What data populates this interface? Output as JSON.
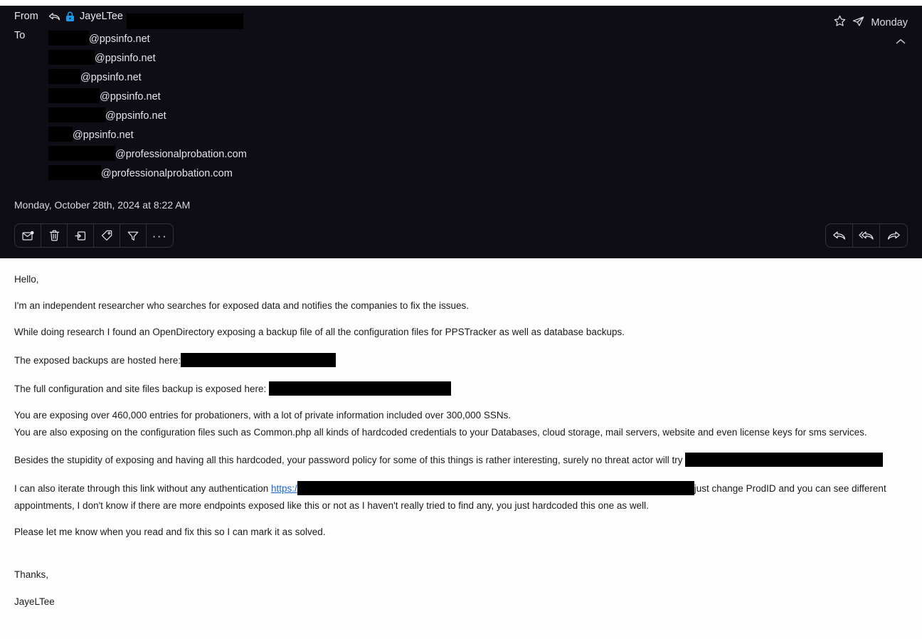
{
  "theme": {
    "header_bg": "#0e0c14",
    "body_bg": "#fdfdfd",
    "header_text": "#e8e8ea",
    "body_text": "#1a1a1a",
    "link_color": "#1967d2",
    "lock_color": "#1a9ae8",
    "redaction_color": "#000000"
  },
  "header": {
    "from_label": "From",
    "to_label": "To",
    "sender_name": "JayeLTee",
    "sender_redacted": true,
    "reply_indicator_icon": "reply-arrow-icon",
    "lock_icon": "lock-icon",
    "recipients": [
      {
        "redacted_width": 57,
        "domain": "@ppsinfo.net"
      },
      {
        "redacted_width": 65,
        "domain": "@ppsinfo.net"
      },
      {
        "redacted_width": 45,
        "domain": "@ppsinfo.net"
      },
      {
        "redacted_width": 72,
        "domain": "@ppsinfo.net"
      },
      {
        "redacted_width": 80,
        "domain": "@ppsinfo.net"
      },
      {
        "redacted_width": 34,
        "domain": "@ppsinfo.net"
      },
      {
        "redacted_width": 94,
        "domain": "@professionalprobation.com"
      },
      {
        "redacted_width": 74,
        "domain": "@professionalprobation.com"
      }
    ],
    "date": "Monday, October 28th, 2024 at 8:22 AM",
    "day_badge": "Monday",
    "star_icon": "star-icon",
    "send_icon": "paper-plane-icon",
    "collapse_icon": "chevron-up-icon"
  },
  "toolbar_left": [
    {
      "name": "mark-unread-button",
      "icon": "envelope-dot-icon"
    },
    {
      "name": "delete-button",
      "icon": "trash-icon"
    },
    {
      "name": "move-to-folder-button",
      "icon": "move-to-folder-icon"
    },
    {
      "name": "tag-button",
      "icon": "tag-icon"
    },
    {
      "name": "filter-button",
      "icon": "funnel-icon"
    },
    {
      "name": "more-options-button",
      "icon": "ellipsis-icon",
      "glyph": "···"
    }
  ],
  "toolbar_right": [
    {
      "name": "reply-button",
      "icon": "reply-arrow-icon"
    },
    {
      "name": "reply-all-button",
      "icon": "reply-all-arrow-icon"
    },
    {
      "name": "forward-button",
      "icon": "forward-arrow-icon"
    }
  ],
  "body": {
    "greeting": "Hello,",
    "p_intro": "I'm an independent researcher who searches for exposed data and notifies the companies to fix the issues.",
    "p_research": "While doing research I found an OpenDirectory exposing a backup file of all the configuration files for PPSTracker as well as database backups.",
    "p_backups_prefix": "The exposed backups are hosted here:",
    "p_backups_redact_width": 218,
    "p_fullconfig_prefix": "The full configuration and site files backup is exposed here:",
    "p_fullconfig_redact_width": 256,
    "p_entries": "You are exposing over 460,000 entries for probationers, with a lot of private information included over 300,000 SSNs.",
    "p_configfiles": "You are also exposing on the configuration files such as Common.php all kinds of hardcoded credentials to your Databases, cloud storage, mail servers, website and even license keys for sms services.",
    "p_password_prefix": "Besides the stupidity of exposing and having all this hardcoded, your password policy for some of this things is rather interesting, surely no threat actor will try",
    "p_password_redact_width": 278,
    "p_link_prefix": "I can also iterate through this link without any authentication",
    "p_link_text": "https:/",
    "p_link_redact_width": 558,
    "p_link_suffix": "just change ProdID and you can see different",
    "p_link_line2": "appointments, I don't know if there are more endpoints exposed like this or not as I haven't really tried to find any, you just hardcoded this one as well.",
    "p_closing": "Please let me know when you read and fix this so I can mark it as solved.",
    "sign_off": "Thanks,",
    "signature": "JayeLTee"
  }
}
